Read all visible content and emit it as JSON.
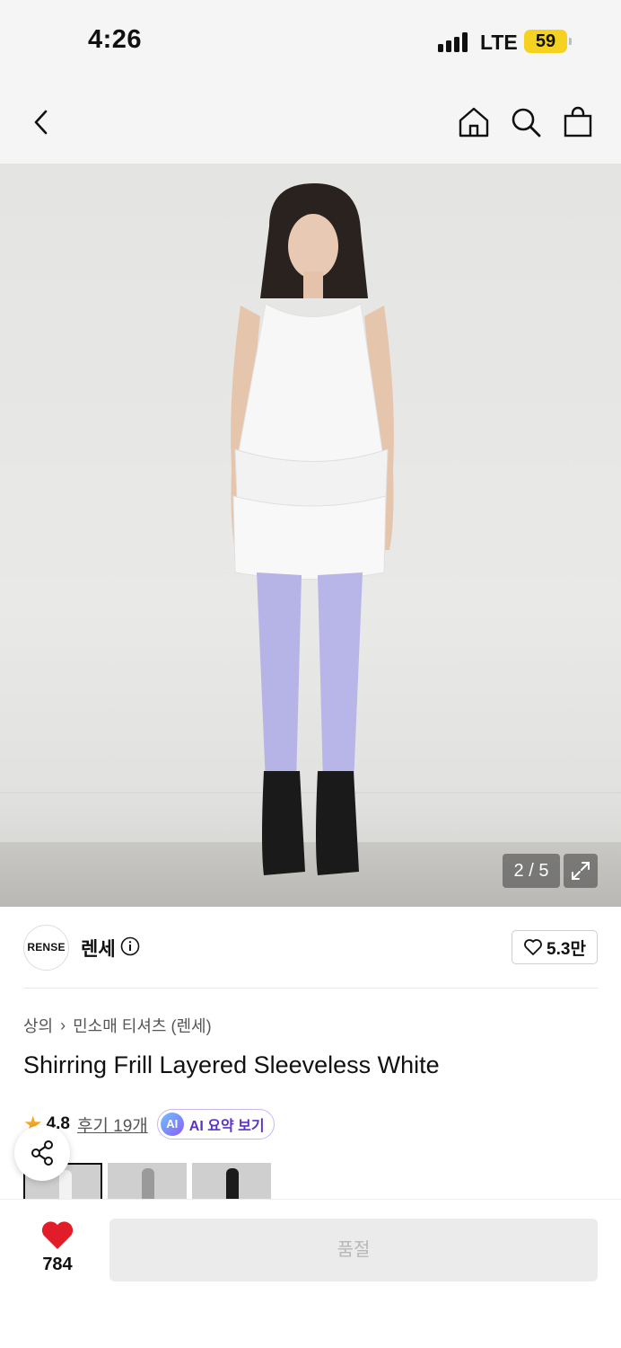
{
  "status_bar": {
    "time": "4:26",
    "network": "LTE",
    "battery": "59"
  },
  "nav": {
    "icons": [
      "back-chevron-icon",
      "home-icon",
      "search-icon",
      "shopping-bag-icon"
    ]
  },
  "gallery": {
    "counter": "2 / 5",
    "current": 2,
    "total": 5
  },
  "brand": {
    "logo_text": "RENSE",
    "name": "렌세",
    "likes": "5.3만"
  },
  "breadcrumb": {
    "category": "상의",
    "separator": "›",
    "subcategory": "민소매 티셔츠 (렌세)"
  },
  "product": {
    "title": "Shirring Frill Layered Sleeveless White"
  },
  "rating": {
    "score": "4.8",
    "reviews": "후기 19개",
    "ai_badge": "AI",
    "ai_label": "AI 요약 보기"
  },
  "colors": {
    "heart": "#e11d2a",
    "star": "#f5a623",
    "ai_accent": "#5a33c9"
  },
  "bottom_bar": {
    "like_count": "784",
    "cta_label": "품절"
  }
}
